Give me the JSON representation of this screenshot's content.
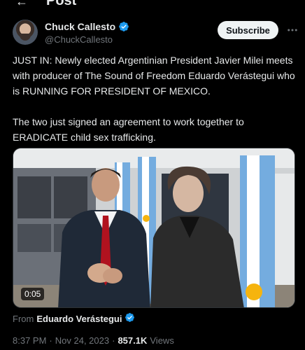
{
  "header": {
    "title": "Post",
    "back_icon": "arrow-left-icon"
  },
  "author": {
    "name": "Chuck Callesto",
    "handle": "@ChuckCallesto",
    "verified_icon": "verified-badge-icon",
    "verified_color": "#1d9bf0"
  },
  "subscribe": {
    "label": "Subscribe"
  },
  "more_icon": "more-horizontal-icon",
  "tweet": {
    "paragraph_1": "JUST IN: Newly elected Argentinian President Javier Milei meets with producer of The Sound of Freedom Eduardo Verástegui who is RUNNING FOR PRESIDENT OF MEXICO.",
    "paragraph_2": "The two just signed an agreement to work together to ERADICATE child sex trafficking."
  },
  "media": {
    "duration": "0:05"
  },
  "source": {
    "prefix": "From",
    "name": "Eduardo Verástegui"
  },
  "meta": {
    "time": "8:37 PM",
    "separator": "·",
    "date": "Nov 24, 2023",
    "views_count": "857.1K",
    "views_label": "Views"
  },
  "colors": {
    "background": "#000000",
    "text": "#e7e9ea",
    "muted": "#71767b",
    "accent": "#1d9bf0"
  }
}
